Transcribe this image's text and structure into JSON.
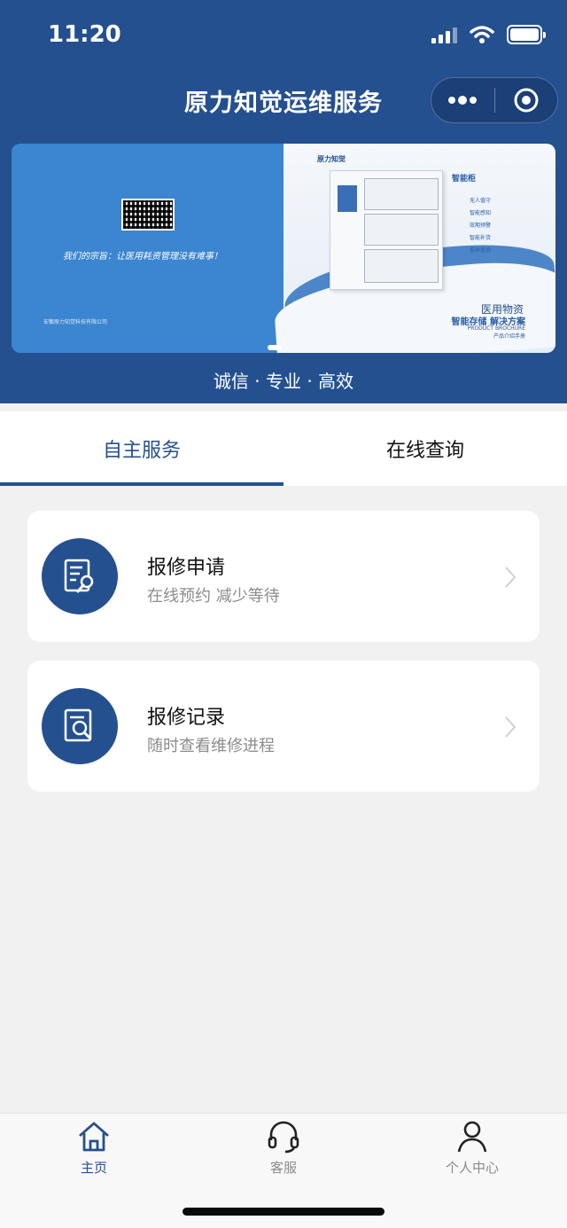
{
  "status_bar": {
    "time": "11:20"
  },
  "nav": {
    "title": "原力知觉运维服务"
  },
  "banner": {
    "slogan": "我们的宗旨：让医用耗资管理没有难事！",
    "company": "安徽原力知觉科技有限公司",
    "brand": "原力知觉",
    "product": "智能柜",
    "features": [
      "无人值守",
      "智能感知",
      "效期预警",
      "智能补货",
      "报表查询"
    ],
    "brochure_title": "医用物资",
    "brochure_sub": "智能存储 解决方案",
    "brochure_en": "PRODUCT BROCHURE",
    "brochure_cn": "产品介绍手册"
  },
  "tagline": "诚信 · 专业 · 高效",
  "tabs": [
    {
      "label": "自主服务",
      "active": true
    },
    {
      "label": "在线查询",
      "active": false
    }
  ],
  "cards": [
    {
      "title": "报修申请",
      "subtitle": "在线预约 减少等待",
      "icon": "repair-document-icon"
    },
    {
      "title": "报修记录",
      "subtitle": "随时查看维修进程",
      "icon": "search-document-icon"
    }
  ],
  "tabbar": [
    {
      "label": "主页",
      "icon": "home-icon",
      "active": true
    },
    {
      "label": "客服",
      "icon": "headset-icon",
      "active": false
    },
    {
      "label": "个人中心",
      "icon": "person-icon",
      "active": false
    }
  ],
  "colors": {
    "primary": "#25508f",
    "background": "#f2f1f2",
    "muted": "#8c8c8c"
  }
}
